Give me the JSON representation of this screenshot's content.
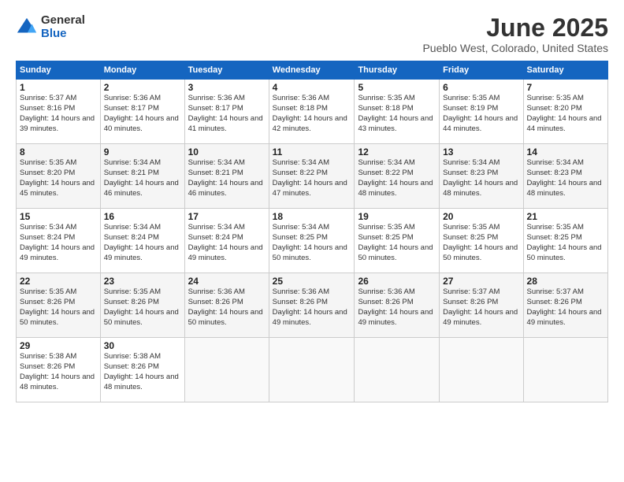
{
  "logo": {
    "general": "General",
    "blue": "Blue"
  },
  "title": "June 2025",
  "location": "Pueblo West, Colorado, United States",
  "headers": [
    "Sunday",
    "Monday",
    "Tuesday",
    "Wednesday",
    "Thursday",
    "Friday",
    "Saturday"
  ],
  "rows": [
    [
      {
        "day": "1",
        "sunrise": "5:37 AM",
        "sunset": "8:16 PM",
        "daylight": "14 hours and 39 minutes."
      },
      {
        "day": "2",
        "sunrise": "5:36 AM",
        "sunset": "8:17 PM",
        "daylight": "14 hours and 40 minutes."
      },
      {
        "day": "3",
        "sunrise": "5:36 AM",
        "sunset": "8:17 PM",
        "daylight": "14 hours and 41 minutes."
      },
      {
        "day": "4",
        "sunrise": "5:36 AM",
        "sunset": "8:18 PM",
        "daylight": "14 hours and 42 minutes."
      },
      {
        "day": "5",
        "sunrise": "5:35 AM",
        "sunset": "8:18 PM",
        "daylight": "14 hours and 43 minutes."
      },
      {
        "day": "6",
        "sunrise": "5:35 AM",
        "sunset": "8:19 PM",
        "daylight": "14 hours and 44 minutes."
      },
      {
        "day": "7",
        "sunrise": "5:35 AM",
        "sunset": "8:20 PM",
        "daylight": "14 hours and 44 minutes."
      }
    ],
    [
      {
        "day": "8",
        "sunrise": "5:35 AM",
        "sunset": "8:20 PM",
        "daylight": "14 hours and 45 minutes."
      },
      {
        "day": "9",
        "sunrise": "5:34 AM",
        "sunset": "8:21 PM",
        "daylight": "14 hours and 46 minutes."
      },
      {
        "day": "10",
        "sunrise": "5:34 AM",
        "sunset": "8:21 PM",
        "daylight": "14 hours and 46 minutes."
      },
      {
        "day": "11",
        "sunrise": "5:34 AM",
        "sunset": "8:22 PM",
        "daylight": "14 hours and 47 minutes."
      },
      {
        "day": "12",
        "sunrise": "5:34 AM",
        "sunset": "8:22 PM",
        "daylight": "14 hours and 48 minutes."
      },
      {
        "day": "13",
        "sunrise": "5:34 AM",
        "sunset": "8:23 PM",
        "daylight": "14 hours and 48 minutes."
      },
      {
        "day": "14",
        "sunrise": "5:34 AM",
        "sunset": "8:23 PM",
        "daylight": "14 hours and 48 minutes."
      }
    ],
    [
      {
        "day": "15",
        "sunrise": "5:34 AM",
        "sunset": "8:24 PM",
        "daylight": "14 hours and 49 minutes."
      },
      {
        "day": "16",
        "sunrise": "5:34 AM",
        "sunset": "8:24 PM",
        "daylight": "14 hours and 49 minutes."
      },
      {
        "day": "17",
        "sunrise": "5:34 AM",
        "sunset": "8:24 PM",
        "daylight": "14 hours and 49 minutes."
      },
      {
        "day": "18",
        "sunrise": "5:34 AM",
        "sunset": "8:25 PM",
        "daylight": "14 hours and 50 minutes."
      },
      {
        "day": "19",
        "sunrise": "5:35 AM",
        "sunset": "8:25 PM",
        "daylight": "14 hours and 50 minutes."
      },
      {
        "day": "20",
        "sunrise": "5:35 AM",
        "sunset": "8:25 PM",
        "daylight": "14 hours and 50 minutes."
      },
      {
        "day": "21",
        "sunrise": "5:35 AM",
        "sunset": "8:25 PM",
        "daylight": "14 hours and 50 minutes."
      }
    ],
    [
      {
        "day": "22",
        "sunrise": "5:35 AM",
        "sunset": "8:26 PM",
        "daylight": "14 hours and 50 minutes."
      },
      {
        "day": "23",
        "sunrise": "5:35 AM",
        "sunset": "8:26 PM",
        "daylight": "14 hours and 50 minutes."
      },
      {
        "day": "24",
        "sunrise": "5:36 AM",
        "sunset": "8:26 PM",
        "daylight": "14 hours and 50 minutes."
      },
      {
        "day": "25",
        "sunrise": "5:36 AM",
        "sunset": "8:26 PM",
        "daylight": "14 hours and 49 minutes."
      },
      {
        "day": "26",
        "sunrise": "5:36 AM",
        "sunset": "8:26 PM",
        "daylight": "14 hours and 49 minutes."
      },
      {
        "day": "27",
        "sunrise": "5:37 AM",
        "sunset": "8:26 PM",
        "daylight": "14 hours and 49 minutes."
      },
      {
        "day": "28",
        "sunrise": "5:37 AM",
        "sunset": "8:26 PM",
        "daylight": "14 hours and 49 minutes."
      }
    ],
    [
      {
        "day": "29",
        "sunrise": "5:38 AM",
        "sunset": "8:26 PM",
        "daylight": "14 hours and 48 minutes."
      },
      {
        "day": "30",
        "sunrise": "5:38 AM",
        "sunset": "8:26 PM",
        "daylight": "14 hours and 48 minutes."
      },
      null,
      null,
      null,
      null,
      null
    ]
  ]
}
